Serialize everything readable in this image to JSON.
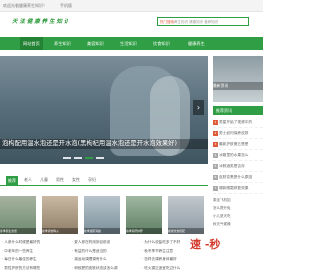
{
  "topbar": {
    "welcome": "欢迎光临健康养生知识！",
    "mobile": "手机版"
  },
  "header": {
    "logo": "天 法 健 康 养 生 知 识",
    "search_hint": "热门搜索：",
    "search_placeholder": "养生知识 健康知识 营养知识"
  },
  "nav": {
    "items": [
      {
        "label": "网站首页"
      },
      {
        "label": "养生知识"
      },
      {
        "label": "美容知识"
      },
      {
        "label": "生活知识"
      },
      {
        "label": "饮食知识"
      },
      {
        "label": "健康养生"
      }
    ]
  },
  "hero": {
    "caption": "泡构配用温水泡还是开水泡(黑枸杞用温水泡还是开水泡效果好)",
    "next_label": "›"
  },
  "side": {
    "image_tag": "最新资讯",
    "head": "推荐资讯",
    "items": [
      {
        "num": "1",
        "text": "男星开始了视频中的"
      },
      {
        "num": "2",
        "text": "男士如何保养皮肤"
      },
      {
        "num": "3",
        "text": "最新护肤第五是是"
      },
      {
        "num": "4",
        "text": "冰箱里的水果怎么"
      },
      {
        "num": "5",
        "text": "冰鲜酒类是否存"
      },
      {
        "num": "6",
        "text": "皮肤变黑是什么原因"
      },
      {
        "num": "7",
        "text": "哪款眼霜修复效果"
      }
    ]
  },
  "tabs": {
    "items": [
      {
        "label": "推荐"
      },
      {
        "label": "老人"
      },
      {
        "label": "儿童"
      },
      {
        "label": "男性"
      },
      {
        "label": "女性"
      },
      {
        "label": "孕妇"
      }
    ]
  },
  "thumbs": [
    {
      "caption": "冬季养生食谱"
    },
    {
      "caption": "夏季清热降火"
    },
    {
      "caption": "秋季滋阴润燥"
    },
    {
      "caption": "春季养肝护肝"
    },
    {
      "caption": "健康饮食搭配"
    }
  ],
  "lists": {
    "col1": [
      "人参什么时候是最好的",
      "中老年的一些养生",
      "每日什么最佳的养生",
      "男性护肝的方法有哪些"
    ],
    "col2": [
      "夏人参在药用到目前该",
      "有益的什么是适当的",
      "减运动调理调有什么",
      "蚂蚁肥的皮肤状态该怎么调"
    ],
    "col3": [
      "为什么说盐吃多了不好",
      "秋冬季节养生注意",
      "怎样去调养身体最好",
      "吃火锅正适宜吃过什么"
    ]
  },
  "side2": [
    "乘坐飞机如",
    "怎么提升免",
    "小儿夏天吃",
    "秋天气候燥"
  ],
  "watermark": "速 -秒"
}
